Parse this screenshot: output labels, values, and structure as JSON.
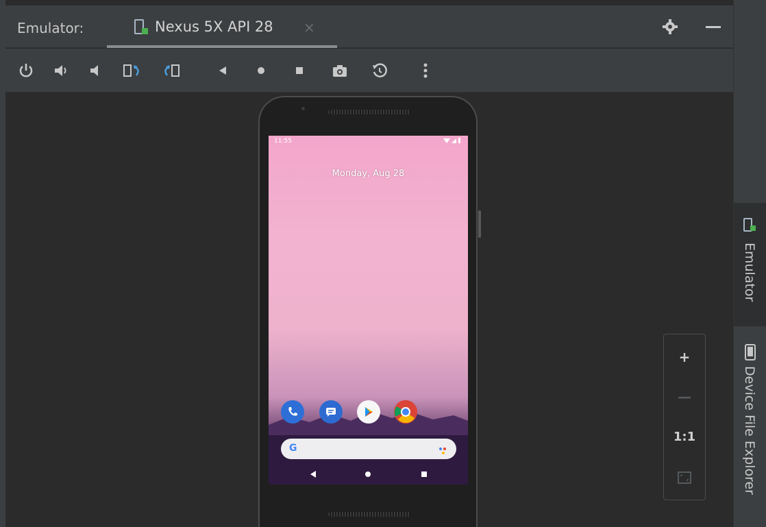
{
  "header": {
    "title": "Emulator:",
    "tab": {
      "label": "Nexus 5X API 28",
      "close": "×"
    }
  },
  "toolbar": {
    "buttons": [
      "power-icon",
      "volume-up-icon",
      "volume-down-icon",
      "rotate-left-icon",
      "rotate-right-icon",
      "back-icon",
      "home-icon",
      "overview-icon",
      "screenshot-icon",
      "snapshot-icon",
      "more-icon"
    ]
  },
  "side_panel": {
    "tabs": [
      {
        "label": "Emulator",
        "active": true
      },
      {
        "label": "Device File Explorer",
        "active": false
      }
    ]
  },
  "zoom": {
    "zoom_in": "+",
    "zoom_out": "—",
    "actual_size": "1:1"
  },
  "phone": {
    "status_time": "11:55",
    "date": "Monday, Aug 28",
    "dock_apps": [
      "phone",
      "messages",
      "play-store",
      "chrome"
    ],
    "search_logo": "G"
  },
  "colors": {
    "panel": "#3c3f41",
    "canvas": "#2b2b2b",
    "accent_green": "#4caf50"
  }
}
